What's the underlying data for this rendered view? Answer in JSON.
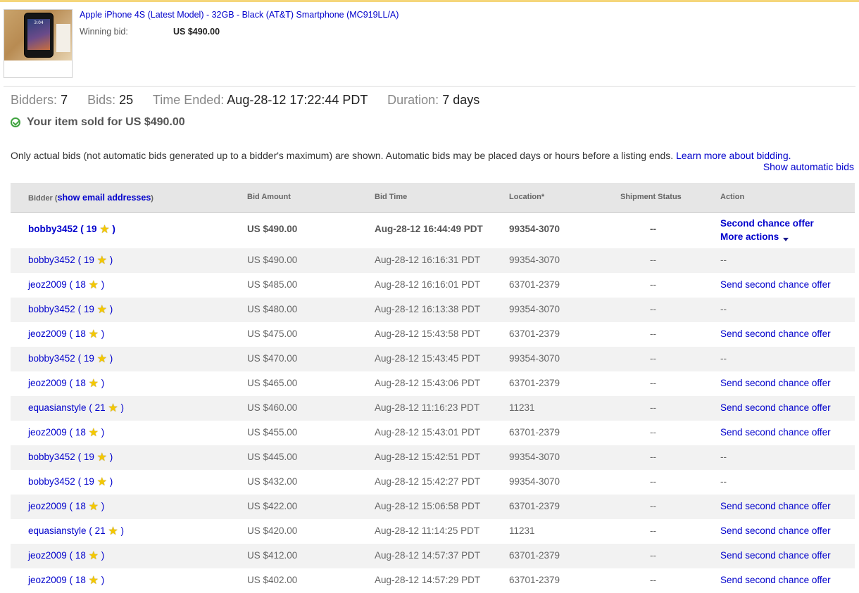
{
  "item": {
    "title": "Apple iPhone 4S (Latest Model) - 32GB - Black (AT&T) Smartphone (MC919LL/A)",
    "winning_bid_label": "Winning bid:",
    "winning_bid_value": "US $490.00",
    "thumb_clock": "3:04"
  },
  "summary": {
    "bidders_label": "Bidders:",
    "bidders_value": "7",
    "bids_label": "Bids:",
    "bids_value": "25",
    "time_ended_label": "Time Ended:",
    "time_ended_value": "Aug-28-12 17:22:44 PDT",
    "duration_label": "Duration:",
    "duration_value": "7 days"
  },
  "sold_message": "Your item sold for US $490.00",
  "note": {
    "text": "Only actual bids (not automatic bids generated up to a bidder's maximum) are shown. Automatic bids may be placed days or hours before a listing ends.",
    "learn_more": "Learn more about bidding.",
    "show_automatic": "Show automatic bids"
  },
  "table": {
    "headers": {
      "bidder": "Bidder",
      "show_email": "show email addresses",
      "bid_amount": "Bid Amount",
      "bid_time": "Bid Time",
      "location": "Location*",
      "shipment_status": "Shipment Status",
      "action": "Action"
    },
    "first_row_actions": {
      "second_chance": "Second chance offer",
      "more_actions": "More actions"
    },
    "rows": [
      {
        "bidder": "bobby3452",
        "score": "19",
        "amount": "US $490.00",
        "time": "Aug-28-12 16:44:49 PDT",
        "location": "99354-3070",
        "ship": "--",
        "action": ""
      },
      {
        "bidder": "bobby3452",
        "score": "19",
        "amount": "US $490.00",
        "time": "Aug-28-12 16:16:31 PDT",
        "location": "99354-3070",
        "ship": "--",
        "action": "--"
      },
      {
        "bidder": "jeoz2009",
        "score": "18",
        "amount": "US $485.00",
        "time": "Aug-28-12 16:16:01 PDT",
        "location": "63701-2379",
        "ship": "--",
        "action": "Send second chance offer"
      },
      {
        "bidder": "bobby3452",
        "score": "19",
        "amount": "US $480.00",
        "time": "Aug-28-12 16:13:38 PDT",
        "location": "99354-3070",
        "ship": "--",
        "action": "--"
      },
      {
        "bidder": "jeoz2009",
        "score": "18",
        "amount": "US $475.00",
        "time": "Aug-28-12 15:43:58 PDT",
        "location": "63701-2379",
        "ship": "--",
        "action": "Send second chance offer"
      },
      {
        "bidder": "bobby3452",
        "score": "19",
        "amount": "US $470.00",
        "time": "Aug-28-12 15:43:45 PDT",
        "location": "99354-3070",
        "ship": "--",
        "action": "--"
      },
      {
        "bidder": "jeoz2009",
        "score": "18",
        "amount": "US $465.00",
        "time": "Aug-28-12 15:43:06 PDT",
        "location": "63701-2379",
        "ship": "--",
        "action": "Send second chance offer"
      },
      {
        "bidder": "equasianstyle",
        "score": "21",
        "amount": "US $460.00",
        "time": "Aug-28-12 11:16:23 PDT",
        "location": "11231",
        "ship": "--",
        "action": "Send second chance offer"
      },
      {
        "bidder": "jeoz2009",
        "score": "18",
        "amount": "US $455.00",
        "time": "Aug-28-12 15:43:01 PDT",
        "location": "63701-2379",
        "ship": "--",
        "action": "Send second chance offer"
      },
      {
        "bidder": "bobby3452",
        "score": "19",
        "amount": "US $445.00",
        "time": "Aug-28-12 15:42:51 PDT",
        "location": "99354-3070",
        "ship": "--",
        "action": "--"
      },
      {
        "bidder": "bobby3452",
        "score": "19",
        "amount": "US $432.00",
        "time": "Aug-28-12 15:42:27 PDT",
        "location": "99354-3070",
        "ship": "--",
        "action": "--"
      },
      {
        "bidder": "jeoz2009",
        "score": "18",
        "amount": "US $422.00",
        "time": "Aug-28-12 15:06:58 PDT",
        "location": "63701-2379",
        "ship": "--",
        "action": "Send second chance offer"
      },
      {
        "bidder": "equasianstyle",
        "score": "21",
        "amount": "US $420.00",
        "time": "Aug-28-12 11:14:25 PDT",
        "location": "11231",
        "ship": "--",
        "action": "Send second chance offer"
      },
      {
        "bidder": "jeoz2009",
        "score": "18",
        "amount": "US $412.00",
        "time": "Aug-28-12 14:57:37 PDT",
        "location": "63701-2379",
        "ship": "--",
        "action": "Send second chance offer"
      },
      {
        "bidder": "jeoz2009",
        "score": "18",
        "amount": "US $402.00",
        "time": "Aug-28-12 14:57:29 PDT",
        "location": "63701-2379",
        "ship": "--",
        "action": "Send second chance offer"
      }
    ]
  },
  "colors": {
    "link": "#0000cc",
    "row_alt": "#f2f2f2",
    "header_bg": "#e6e6e6",
    "star": "#f4c800",
    "success": "#3fa33f"
  }
}
